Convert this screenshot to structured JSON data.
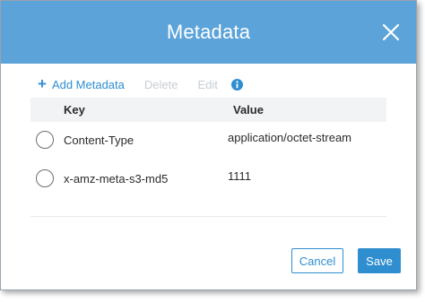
{
  "dialog": {
    "title": "Metadata",
    "close_icon": "close-icon"
  },
  "toolbar": {
    "add_label": "Add Metadata",
    "add_icon": "plus-icon",
    "delete_label": "Delete",
    "edit_label": "Edit",
    "info_icon": "info-icon"
  },
  "table": {
    "columns": [
      "Key",
      "Value"
    ],
    "rows": [
      {
        "key": "Content-Type",
        "value": "application/octet-stream",
        "selected": false
      },
      {
        "key": "x-amz-meta-s3-md5",
        "value": "1111",
        "selected": false
      }
    ]
  },
  "footer": {
    "cancel_label": "Cancel",
    "save_label": "Save"
  },
  "colors": {
    "header": "#5ba3d8",
    "accent": "#2f8ed0",
    "disabled": "#c8ced4"
  }
}
